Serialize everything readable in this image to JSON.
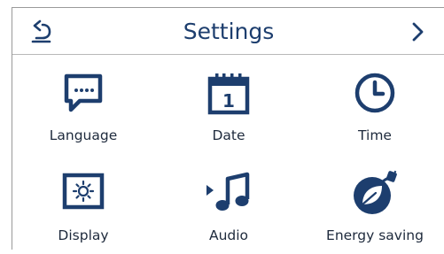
{
  "header": {
    "title": "Settings"
  },
  "tiles": [
    {
      "label": "Language",
      "icon": "speech-bubble-icon"
    },
    {
      "label": "Date",
      "icon": "calendar-icon",
      "calendar_day": "1"
    },
    {
      "label": "Time",
      "icon": "clock-icon"
    },
    {
      "label": "Display",
      "icon": "brightness-icon"
    },
    {
      "label": "Audio",
      "icon": "music-note-icon"
    },
    {
      "label": "Energy saving",
      "icon": "leaf-plug-icon"
    }
  ],
  "colors": {
    "icon": "#1d3e6e",
    "text": "#1e2a3c",
    "border": "#9a9a9a"
  }
}
